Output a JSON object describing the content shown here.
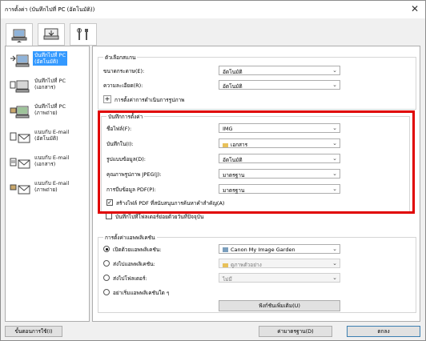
{
  "window": {
    "title": "การตั้งค่า (บันทึกไปที่ PC (อัตโนมัติ))",
    "close": "✕"
  },
  "tabs": [
    {
      "name": "scan-from-computer"
    },
    {
      "name": "scan-from-panel"
    },
    {
      "name": "general-settings"
    }
  ],
  "sidebar": {
    "items": [
      {
        "label": "บันทึกไปที่ PC\n(อัตโนมัติ)",
        "selected": true
      },
      {
        "label": "บันทึกไปที่ PC\n(เอกสาร)"
      },
      {
        "label": "บันทึกไปที่ PC\n(ภาพถ่าย)"
      },
      {
        "label": "แนบกับ E-mail\n(อัตโนมัติ)"
      },
      {
        "label": "แนบกับ E-mail\n(เอกสาร)"
      },
      {
        "label": "แนบกับ E-mail\n(ภาพถ่าย)"
      }
    ]
  },
  "scan_options": {
    "title": "ตัวเลือกสแกน",
    "paper_size_label": "ขนาดกระดาษ(E):",
    "paper_size_value": "อัตโนมัติ",
    "resolution_label": "ความละเอียด(R):",
    "resolution_value": "อัตโนมัติ",
    "image_processing_label": "การตั้งค่าการดำเนินการรูปภาพ"
  },
  "save_settings": {
    "title": "บันทึกการตั้งค่า",
    "file_name_label": "ชื่อไฟล์(F):",
    "file_name_value": "IMG",
    "save_in_label": "บันทึกใน(I):",
    "save_in_value": "เอกสาร",
    "data_format_label": "รูปแบบข้อมูล(D):",
    "data_format_value": "อัตโนมัติ",
    "jpeg_quality_label": "คุณภาพรูปภาพ JPEG(J):",
    "jpeg_quality_value": "มาตรฐาน",
    "pdf_compression_label": "การบีบข้อมูล PDF(P):",
    "pdf_compression_value": "มาตรฐาน",
    "pdf_keyword_label": "สร้างไฟล์ PDF ที่สนับสนุนการค้นหาคำสำคัญ(A)",
    "pdf_keyword_checked": true,
    "subfolder_label": "บันทึกไปที่โฟลเดอร์ย่อยด้วยวันที่ปัจจุบัน",
    "subfolder_checked": false
  },
  "app_settings": {
    "title": "การตั้งค่าแอพพลิเคชัน",
    "open_app_label": "เปิดด้วยแอพพลิเคชัน:",
    "open_app_value": "Canon My Image Garden",
    "open_app_selected": true,
    "send_app_label": "ส่งไปแอพพลิเคชัน:",
    "send_app_value": "ดูภาพตัวอย่าง",
    "send_folder_label": "ส่งไปโฟลเดอร์:",
    "send_folder_value": "ไม่มี",
    "no_app_label": "อย่าเริ่มแอพพลิเคชันใด ๆ",
    "more_functions_label": "ฟังก์ชันเพิ่มเติม(U)"
  },
  "footer": {
    "instructions_label": "ขั้นตอนการใช้(I)",
    "defaults_label": "ค่ามาตรฐาน(D)",
    "ok_label": "ตกลง"
  },
  "colors": {
    "highlight": "#e00000",
    "selection": "#3399ff"
  }
}
